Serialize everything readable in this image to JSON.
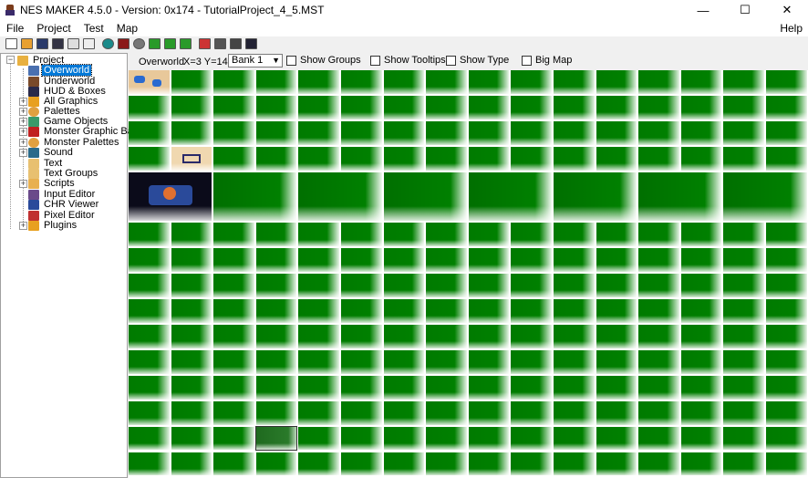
{
  "window": {
    "title": "NES MAKER 4.5.0 - Version: 0x174 - TutorialProject_4_5.MST",
    "controls": {
      "minimize": "—",
      "maximize": "☐",
      "close": "✕"
    }
  },
  "menu": {
    "items": [
      "File",
      "Project",
      "Test",
      "Map"
    ],
    "help": "Help"
  },
  "tree": {
    "root": "Project",
    "items": [
      {
        "label": "Overworld",
        "icon": "overworld-map-icon",
        "selected": true
      },
      {
        "label": "Underworld",
        "icon": "underworld-map-icon"
      },
      {
        "label": "HUD & Boxes",
        "icon": "hud-icon"
      },
      {
        "label": "All Graphics",
        "icon": "folder-icon",
        "expandable": true
      },
      {
        "label": "Palettes",
        "icon": "palette-icon",
        "expandable": true
      },
      {
        "label": "Game Objects",
        "icon": "game-object-icon",
        "expandable": true
      },
      {
        "label": "Monster Graphic Banks",
        "icon": "monster-icon",
        "expandable": true
      },
      {
        "label": "Monster Palettes",
        "icon": "palette-icon",
        "expandable": true
      },
      {
        "label": "Sound",
        "icon": "sound-icon",
        "expandable": true
      },
      {
        "label": "Text",
        "icon": "text-icon"
      },
      {
        "label": "Text Groups",
        "icon": "text-groups-icon"
      },
      {
        "label": "Scripts",
        "icon": "scripts-icon",
        "expandable": true
      },
      {
        "label": "Input Editor",
        "icon": "input-icon"
      },
      {
        "label": "CHR Viewer",
        "icon": "chr-icon"
      },
      {
        "label": "Pixel Editor",
        "icon": "pencil-icon"
      },
      {
        "label": "Plugins",
        "icon": "folder-icon",
        "expandable": true
      }
    ]
  },
  "options": {
    "map_name": "Overworld",
    "coords": "X=3 Y=14",
    "bank": "Bank 1",
    "show_groups": "Show Groups",
    "show_tooltips": "Show Tooltips",
    "show_type": "Show Type",
    "big_map": "Big Map"
  },
  "colors": {
    "cell_green": "#008000",
    "selection_blue": "#0078d7"
  }
}
